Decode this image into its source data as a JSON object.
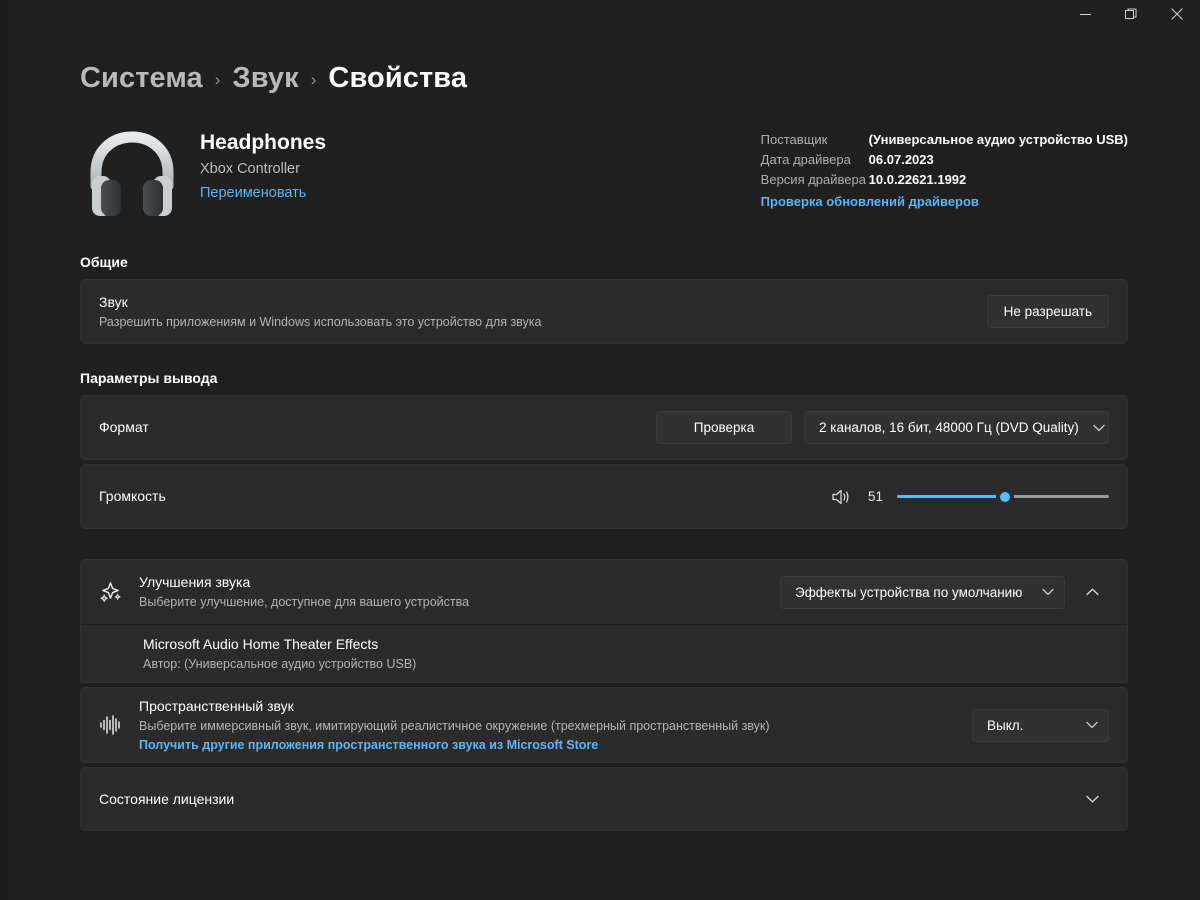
{
  "titlebar": {
    "minimize": "minimize-icon",
    "restore": "restore-icon",
    "close": "close-icon"
  },
  "breadcrumb": {
    "items": [
      "Система",
      "Звук",
      "Свойства"
    ],
    "separator": "›"
  },
  "device": {
    "icon": "headphones-icon",
    "name": "Headphones",
    "subtitle": "Xbox Controller",
    "rename_link": "Переименовать",
    "driver": {
      "vendor_label": "Поставщик",
      "vendor_value": "(Универсальное аудио устройство USB)",
      "date_label": "Дата драйвера",
      "date_value": "06.07.2023",
      "version_label": "Версия драйвера",
      "version_value": "10.0.22621.1992",
      "update_link": "Проверка обновлений драйверов"
    }
  },
  "general": {
    "heading": "Общие",
    "sound": {
      "title": "Звук",
      "subtitle": "Разрешить приложениям и Windows использовать это устройство для звука",
      "button": "Не разрешать"
    }
  },
  "output": {
    "heading": "Параметры вывода",
    "format": {
      "title": "Формат",
      "test_button": "Проверка",
      "value": "2 каналов, 16 бит, 48000 Гц (DVD Quality)"
    },
    "volume": {
      "title": "Громкость",
      "icon": "speaker-icon",
      "value": 51,
      "min": 0,
      "max": 100
    }
  },
  "enhancements": {
    "icon": "sparkle-icon",
    "title": "Улучшения звука",
    "subtitle": "Выберите улучшение, доступное для вашего устройства",
    "value": "Эффекты устройства по умолчанию",
    "expanded": true,
    "expander_icon": "chevron-up-icon",
    "item": {
      "title": "Microsoft Audio Home Theater Effects",
      "subtitle": "Автор: (Универсальное аудио устройство USB)"
    }
  },
  "spatial": {
    "icon": "waveform-icon",
    "title": "Пространственный звук",
    "subtitle": "Выберите иммерсивный звук, имитирующий реалистичное окружение (трехмерный пространственный звук)",
    "store_link": "Получить другие приложения пространственного звука из Microsoft Store",
    "value": "Выкл."
  },
  "license": {
    "title": "Состояние лицензии",
    "expander_icon": "chevron-down-icon"
  },
  "colors": {
    "page_background": "#202020",
    "card_background": "#2b2b2b",
    "accent": "#4cc2ff",
    "link": "#5eb5f0"
  }
}
